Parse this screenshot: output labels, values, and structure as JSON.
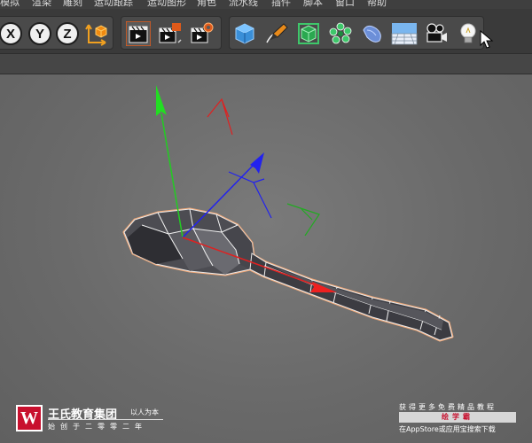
{
  "menubar": {
    "items": [
      "模拟",
      "渲染",
      "雕刻",
      "运动跟踪",
      "运动图形",
      "角色",
      "流水线",
      "插件",
      "脚本",
      "窗口",
      "帮助"
    ]
  },
  "toolbar": {
    "axis_x": "X",
    "axis_y": "Y",
    "axis_z": "Z",
    "icons": [
      "x-axis-lock-icon",
      "y-axis-lock-icon",
      "z-axis-lock-icon",
      "coordinate-system-icon",
      "render-view-icon",
      "render-picture-viewer-icon",
      "render-settings-icon",
      "cube-icon",
      "pen-spline-icon",
      "subdivision-surface-icon",
      "cloner-icon",
      "deformer-icon",
      "floor-icon",
      "camera-icon",
      "light-icon"
    ]
  },
  "colors": {
    "axis_x": "#e02020",
    "axis_y": "#22cc22",
    "axis_z": "#2222ee",
    "selection": "#f0a878",
    "viewport_bg": "#6a6a6a"
  },
  "watermark": {
    "logo_glyph": "W",
    "name": "王氏教育集团",
    "motto": "以人为本",
    "founded": "始创于二零零二年"
  },
  "promo": {
    "line1": "获得更多免费精品教程",
    "app_name": "绘学霸",
    "line3": "在AppStore或应用宝搜索下载"
  }
}
